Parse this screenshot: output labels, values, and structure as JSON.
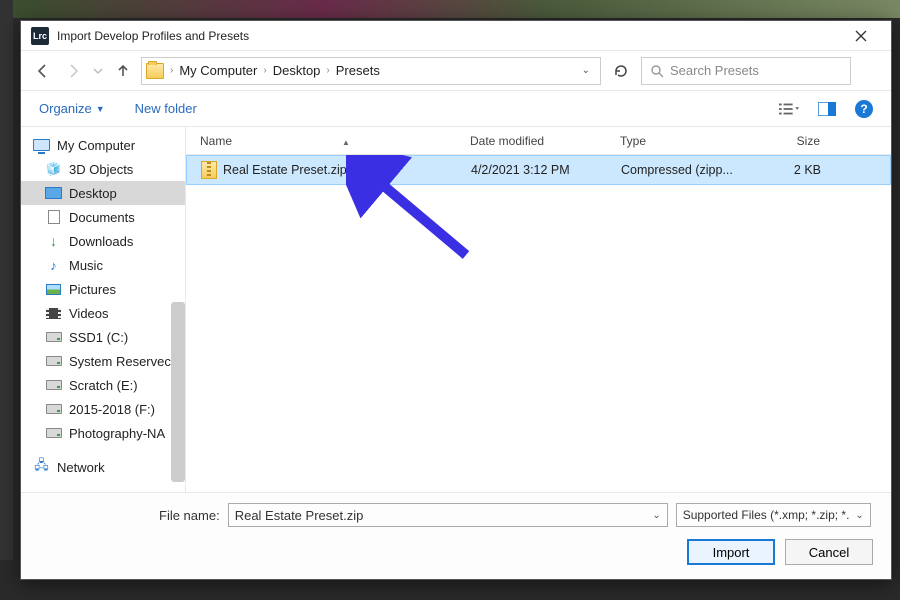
{
  "window": {
    "title": "Import Develop Profiles and Presets",
    "app_badge": "Lrc"
  },
  "breadcrumb": {
    "root": "My Computer",
    "p1": "Desktop",
    "p2": "Presets"
  },
  "search": {
    "placeholder": "Search Presets"
  },
  "toolbar": {
    "organize": "Organize",
    "newfolder": "New folder"
  },
  "columns": {
    "name": "Name",
    "date": "Date modified",
    "type": "Type",
    "size": "Size"
  },
  "sidebar": {
    "my_computer": "My Computer",
    "objects3d": "3D Objects",
    "desktop": "Desktop",
    "documents": "Documents",
    "downloads": "Downloads",
    "music": "Music",
    "pictures": "Pictures",
    "videos": "Videos",
    "ssd1": "SSD1 (C:)",
    "sysres": "System Reservec",
    "scratch": "Scratch (E:)",
    "y2015": "2015-2018 (F:)",
    "photo": "Photography-NA",
    "network": "Network"
  },
  "file": {
    "name": "Real Estate Preset.zip",
    "date": "4/2/2021 3:12 PM",
    "type": "Compressed (zipp...",
    "size": "2 KB"
  },
  "footer": {
    "filename_label": "File name:",
    "filename_value": "Real Estate Preset.zip",
    "filter": "Supported Files (*.xmp; *.zip; *.",
    "import": "Import",
    "cancel": "Cancel"
  }
}
